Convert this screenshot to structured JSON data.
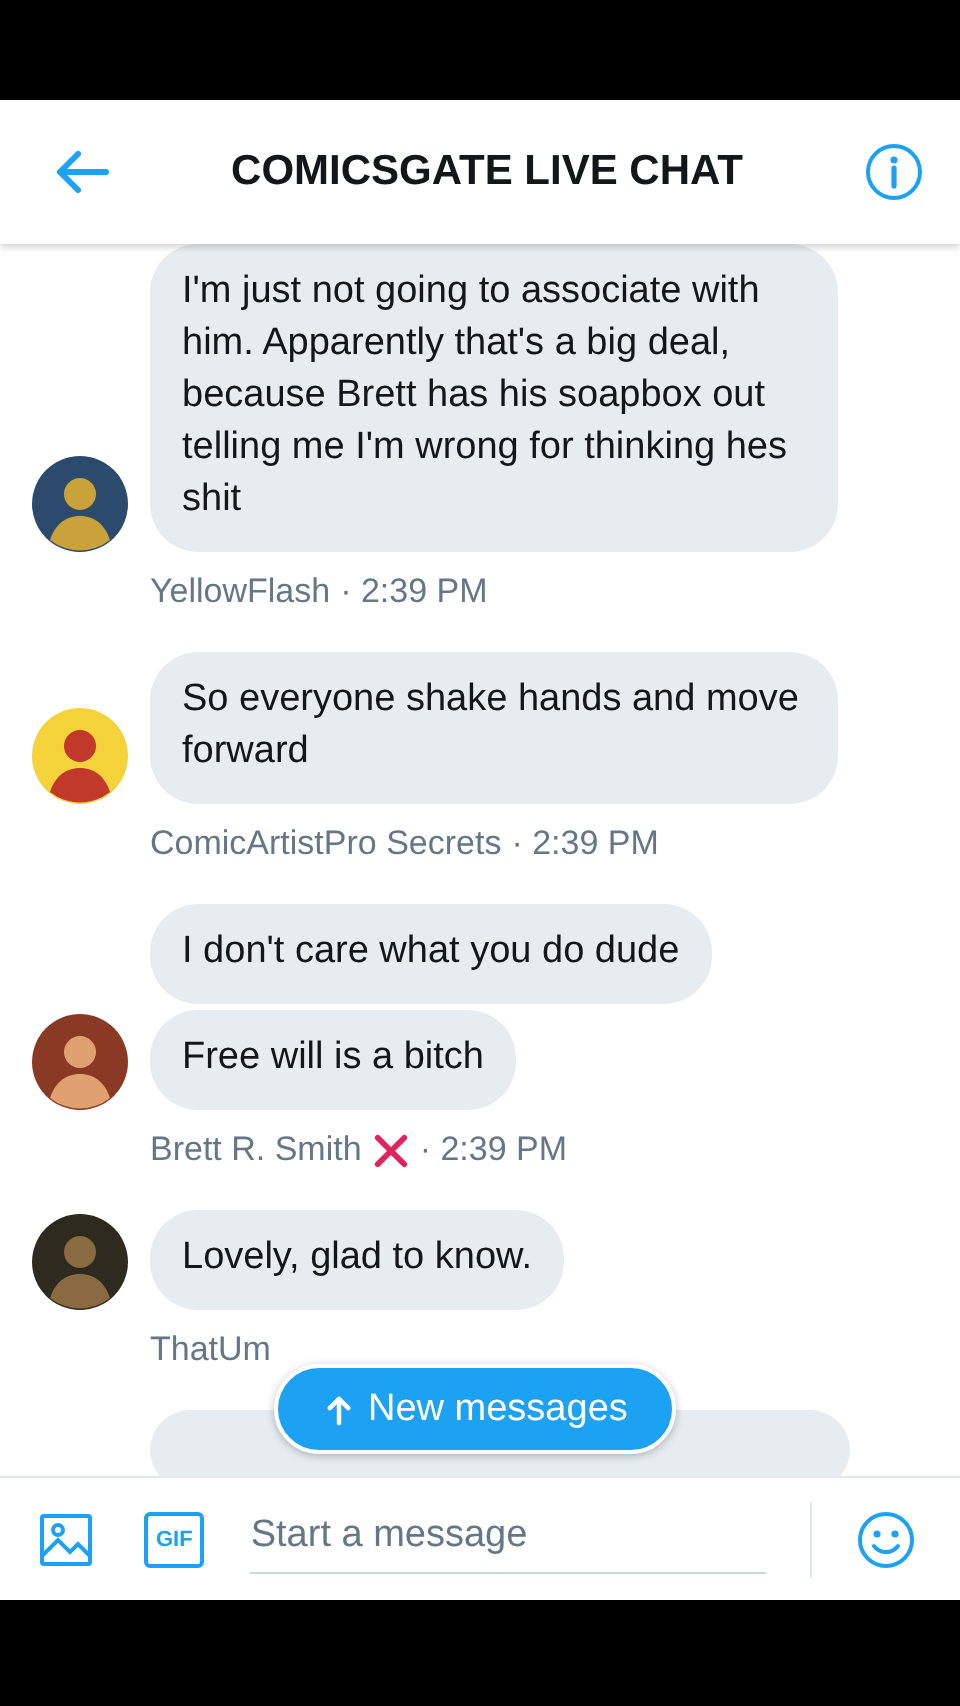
{
  "header": {
    "title": "COMICSGATE LIVE CHAT"
  },
  "groups": [
    {
      "messages": [
        "I'm just not going to associate with him. Apparently that's a big deal, because Brett has his soapbox out telling me I'm wrong for thinking hes shit"
      ],
      "name": "YellowFlash",
      "flagged": false,
      "time": "· 2:39 PM"
    },
    {
      "messages": [
        "So everyone shake hands and move forward"
      ],
      "name": "ComicArtistPro Secrets",
      "flagged": false,
      "time": "· 2:39 PM"
    },
    {
      "messages": [
        "I don't care what you do dude",
        "Free will is a bitch"
      ],
      "name": "Brett R. Smith",
      "flagged": true,
      "time": "· 2:39 PM"
    },
    {
      "messages": [
        "Lovely, glad to know."
      ],
      "name": "ThatUm",
      "flagged": false
    }
  ],
  "more_below": true,
  "new_messages": {
    "label": "New messages"
  },
  "composer": {
    "placeholder": "Start a message",
    "gif_label": "GIF"
  }
}
